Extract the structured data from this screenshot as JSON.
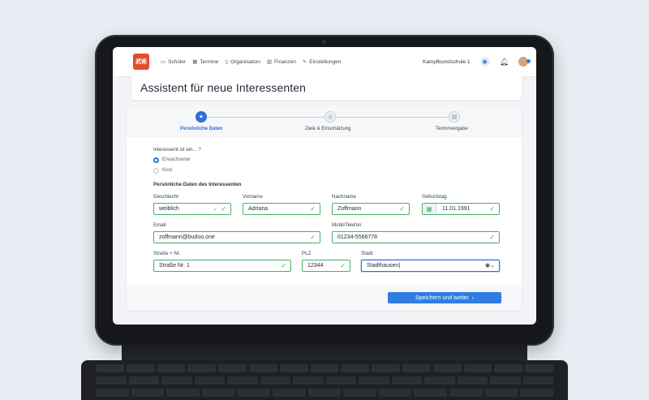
{
  "app": {
    "logo_text": "武術",
    "nav": [
      {
        "label": "Schüler",
        "icon": "id-card-icon"
      },
      {
        "label": "Termine",
        "icon": "calendar-icon"
      },
      {
        "label": "Organisation",
        "icon": "clipboard-icon"
      },
      {
        "label": "Finanzen",
        "icon": "bar-chart-icon"
      },
      {
        "label": "Einstellungen",
        "icon": "wrench-icon"
      }
    ],
    "school_name": "Kampfkunstschule 1"
  },
  "page_title": "Assistent für neue Interessenten",
  "steps": [
    {
      "label": "Persönliche Daten",
      "icon": "lock-icon",
      "active": true
    },
    {
      "label": "Ziele & Einschätzung",
      "icon": "target-icon",
      "active": false
    },
    {
      "label": "Terminvergabe",
      "icon": "calendar-check-icon",
      "active": false
    }
  ],
  "form": {
    "question": "Interessent ist ein... ?",
    "options": [
      "Erwachsener",
      "Kind"
    ],
    "selected_option": "Erwachsener",
    "section_title": "Persönliche Daten des Interessenten",
    "fields": {
      "geschlecht": {
        "label": "Geschlecht",
        "value": "weiblich"
      },
      "vorname": {
        "label": "Vorname",
        "value": "Adriana"
      },
      "nachname": {
        "label": "Nachname",
        "value": "Zoffmann"
      },
      "geburtstag": {
        "label": "Geburtstag",
        "value": "11.01.1991"
      },
      "email": {
        "label": "Email",
        "value": "zoffmann@budoo.one"
      },
      "mobil": {
        "label": "Mobil/Telefon",
        "value": "01234-5566778"
      },
      "strasse": {
        "label": "Straße + Nr.",
        "value": "Straße Nr. 1"
      },
      "plz": {
        "label": "PLZ",
        "value": "12344"
      },
      "stadt": {
        "label": "Stadt",
        "value": "Stadthausen"
      }
    },
    "submit_label": "Speichern und weiter"
  },
  "colors": {
    "primary": "#2f7de1",
    "valid": "#46b06b",
    "logo": "#e44a2c"
  }
}
